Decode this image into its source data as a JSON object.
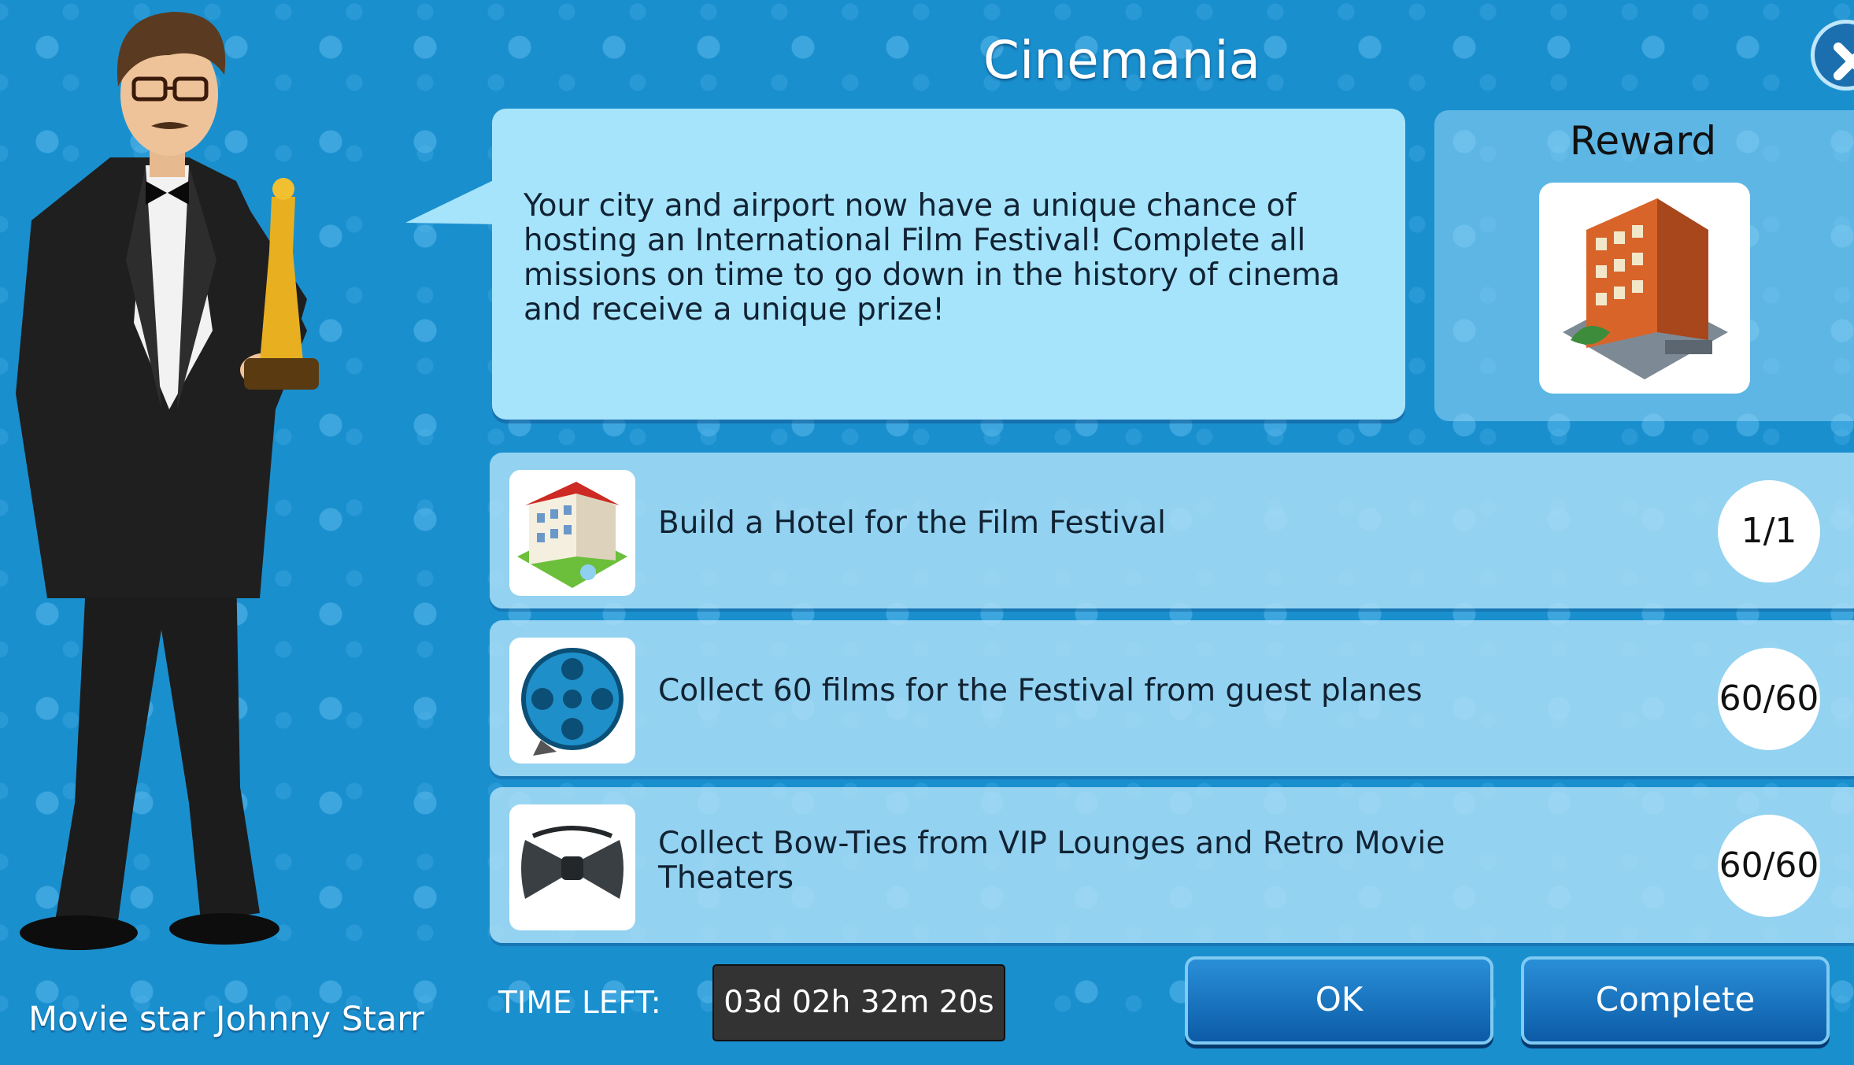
{
  "window": {
    "title": "Cinemania"
  },
  "npc": {
    "name": "Movie star Johnny Starr"
  },
  "intro": {
    "text": "Your city and airport now have a unique chance of hosting an International Film Festival! Complete all missions on time to go down in the history of cinema and receive a unique prize!"
  },
  "reward": {
    "title": "Reward",
    "icon": "building-reward-icon"
  },
  "missions": [
    {
      "label": "Build a Hotel for the Film Festival",
      "progress": "1/1",
      "icon": "hotel-icon"
    },
    {
      "label": "Collect 60 films for the Festival from guest planes",
      "progress": "60/60",
      "icon": "film-reel-icon"
    },
    {
      "label": "Collect Bow-Ties from VIP Lounges and Retro Movie Theaters",
      "progress": "60/60",
      "icon": "bow-tie-icon"
    }
  ],
  "footer": {
    "time_left_label": "TIME LEFT:",
    "time_left_value": "03d 02h 32m 20s",
    "ok_label": "OK",
    "complete_label": "Complete"
  },
  "colors": {
    "background": "#1a8fce",
    "speech_bubble": "#a6e4fb",
    "button": "#0c5ba7"
  }
}
